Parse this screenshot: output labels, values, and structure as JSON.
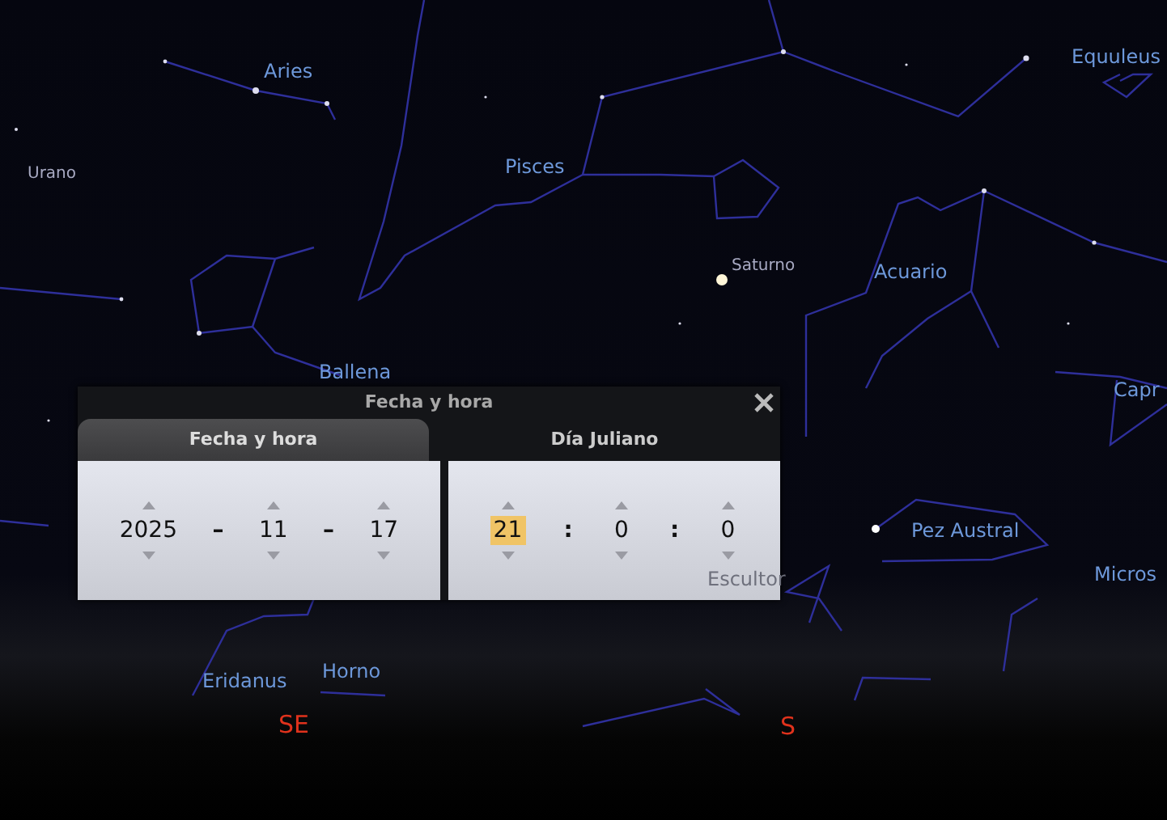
{
  "sky_labels": [
    {
      "text": "Aries",
      "kind": "constellation"
    },
    {
      "text": "Urano",
      "kind": "planet"
    },
    {
      "text": "Pisces",
      "kind": "constellation"
    },
    {
      "text": "Saturno",
      "kind": "planet"
    },
    {
      "text": "Acuario",
      "kind": "constellation"
    },
    {
      "text": "Equuleus",
      "kind": "constellation"
    },
    {
      "text": "Ballena",
      "kind": "constellation"
    },
    {
      "text": "Capr",
      "kind": "constellation"
    },
    {
      "text": "Pez Austral",
      "kind": "constellation"
    },
    {
      "text": "Micros",
      "kind": "constellation"
    },
    {
      "text": "Eridanus",
      "kind": "constellation"
    },
    {
      "text": "Horno",
      "kind": "constellation"
    },
    {
      "text": "Escultor",
      "kind": "faded"
    },
    {
      "text": "SE",
      "kind": "cardinal"
    },
    {
      "text": "S",
      "kind": "cardinal"
    }
  ],
  "dialog": {
    "title": "Fecha y hora",
    "tabs": [
      {
        "label": "Fecha y hora",
        "selected": true
      },
      {
        "label": "Día Juliano",
        "selected": false
      }
    ],
    "panels": [
      {
        "fields": [
          {
            "kind": "spinner",
            "value": "2025",
            "selected": false
          },
          {
            "kind": "separator",
            "value": "–"
          },
          {
            "kind": "spinner",
            "value": "11",
            "selected": false
          },
          {
            "kind": "separator",
            "value": "–"
          },
          {
            "kind": "spinner",
            "value": "17",
            "selected": false
          }
        ]
      },
      {
        "fields": [
          {
            "kind": "spinner",
            "value": "21",
            "selected": true
          },
          {
            "kind": "separator",
            "value": ":"
          },
          {
            "kind": "spinner",
            "value": "0",
            "selected": false
          },
          {
            "kind": "separator",
            "value": ":"
          },
          {
            "kind": "spinner",
            "value": "0",
            "selected": false
          }
        ]
      }
    ]
  }
}
